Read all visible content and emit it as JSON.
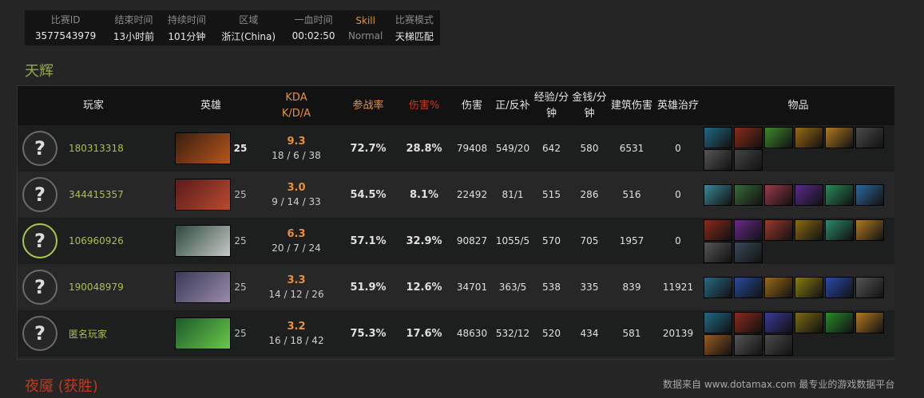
{
  "match_info": {
    "labels": [
      "比赛ID",
      "结束时间",
      "持续时间",
      "区域",
      "一血时间",
      "Skill",
      "比赛模式"
    ],
    "values": [
      "3577543979",
      "13小时前",
      "101分钟",
      "浙江(China)",
      "00:02:50",
      "Normal",
      "天梯匹配"
    ]
  },
  "radiant": {
    "title": "天辉"
  },
  "dire": {
    "title": "夜魇 (获胜)"
  },
  "credit": "数据来自 www.dotamax.com 最专业的游戏数据平台",
  "columns": [
    "玩家",
    "英雄",
    "KDA K/D/A",
    "参战率",
    "伤害%",
    "伤害",
    "正/反补",
    "经验/分钟",
    "金钱/分钟",
    "建筑伤害",
    "英雄治疗",
    "物品"
  ],
  "colors": {
    "accent_orange": "#e8913a",
    "accent_red": "#c23a1e",
    "player_green": "#a5c24a",
    "radiant_green": "#8fae3f"
  },
  "players": [
    {
      "avatar": "?",
      "name": "180313318",
      "level": "25",
      "kda_ratio": "9.3",
      "kda": "18 / 6 / 38",
      "participation": "72.7%",
      "damage_pct": "28.8%",
      "damage": "79408",
      "lh_dn": "549/20",
      "xpm": "642",
      "gpm": "580",
      "building": "6531",
      "healing": "0",
      "hero_colors": [
        "#3a1e10",
        "#b8561c"
      ],
      "items": [
        "#1f6a84",
        "#8a2a1a",
        "#3e8a2a",
        "#9a6a14",
        "#b07a22",
        "#4a4a4a",
        "#555555",
        "#444444"
      ]
    },
    {
      "avatar": "?",
      "name": "344415357",
      "level": "25",
      "kda_ratio": "3.0",
      "kda": "9 / 14 / 33",
      "participation": "54.5%",
      "damage_pct": "8.1%",
      "damage": "22492",
      "lh_dn": "81/1",
      "xpm": "515",
      "gpm": "286",
      "building": "516",
      "healing": "0",
      "hero_colors": [
        "#5a1a1a",
        "#b84a30"
      ],
      "items": [
        "#3a8a9a",
        "#3a6a3a",
        "#9a3a4a",
        "#5a2a8a",
        "#2a8a5a",
        "#2a6a9a"
      ]
    },
    {
      "avatar": "?",
      "name": "106960926",
      "level": "25",
      "kda_ratio": "6.3",
      "kda": "20 / 7 / 24",
      "participation": "57.1%",
      "damage_pct": "32.9%",
      "damage": "90827",
      "lh_dn": "1055/5",
      "xpm": "570",
      "gpm": "705",
      "building": "1957",
      "healing": "0",
      "hero_colors": [
        "#2a4a3a",
        "#c8c8c8"
      ],
      "items": [
        "#8a2a1a",
        "#6a2a8a",
        "#9a3a2a",
        "#8a6a14",
        "#2a8a6a",
        "#b07a22",
        "#555555",
        "#3a4a5a"
      ]
    },
    {
      "avatar": "?",
      "name": "190048979",
      "level": "25",
      "kda_ratio": "3.3",
      "kda": "14 / 12 / 26",
      "participation": "51.9%",
      "damage_pct": "12.6%",
      "damage": "34701",
      "lh_dn": "363/5",
      "xpm": "538",
      "gpm": "335",
      "building": "839",
      "healing": "11921",
      "hero_colors": [
        "#3a3a5a",
        "#9a8aa8"
      ],
      "items": [
        "#2a6a84",
        "#2a4a9a",
        "#9a6a14",
        "#8a7a14",
        "#2a4aa8",
        "#555555"
      ]
    },
    {
      "avatar": "?",
      "name": "匿名玩家",
      "level": "25",
      "kda_ratio": "3.2",
      "kda": "16 / 18 / 42",
      "participation": "75.3%",
      "damage_pct": "17.6%",
      "damage": "48630",
      "lh_dn": "532/12",
      "xpm": "520",
      "gpm": "434",
      "building": "581",
      "healing": "20139",
      "hero_colors": [
        "#1a5a2a",
        "#6ac84a"
      ],
      "items": [
        "#1f6a84",
        "#8a2a1a",
        "#3a3a9a",
        "#7a6a14",
        "#2a8a2a",
        "#b07a22",
        "#9a5a22",
        "#555555",
        "#4a4a4a"
      ]
    }
  ]
}
